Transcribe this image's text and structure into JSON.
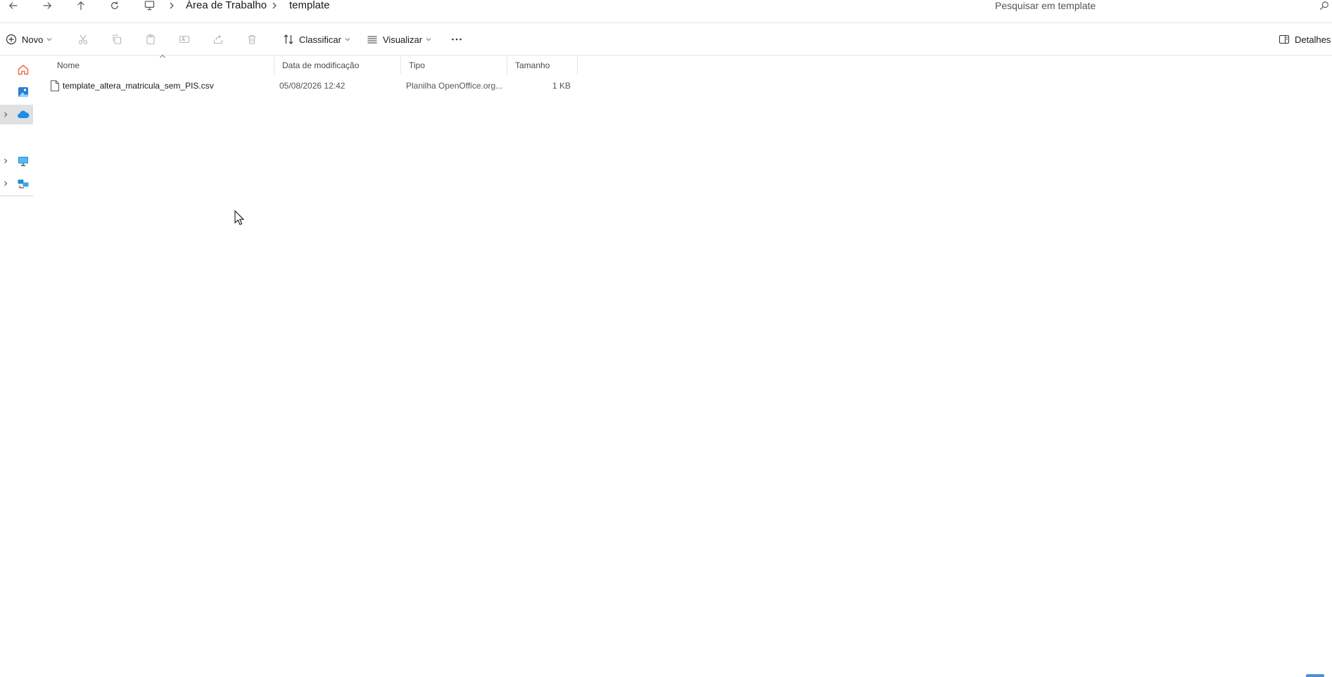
{
  "address": {
    "breadcrumbs": [
      "Área de Trabalho",
      "template"
    ],
    "search_placeholder": "Pesquisar em template"
  },
  "toolbar": {
    "new_label": "Novo",
    "sort_label": "Classificar",
    "view_label": "Visualizar",
    "details_label": "Detalhes"
  },
  "columns": {
    "name": "Nome",
    "modified": "Data de modificação",
    "type": "Tipo",
    "size": "Tamanho"
  },
  "files": [
    {
      "name": "template_altera_matricula_sem_PIS.csv",
      "modified": "05/08/2026 12:42",
      "type": "Planilha OpenOffice.org...",
      "size": "1 KB"
    }
  ],
  "colors": {
    "accent": "#0067c0",
    "home_icon": "#e8704a",
    "onedrive": "#1a8ee8"
  }
}
